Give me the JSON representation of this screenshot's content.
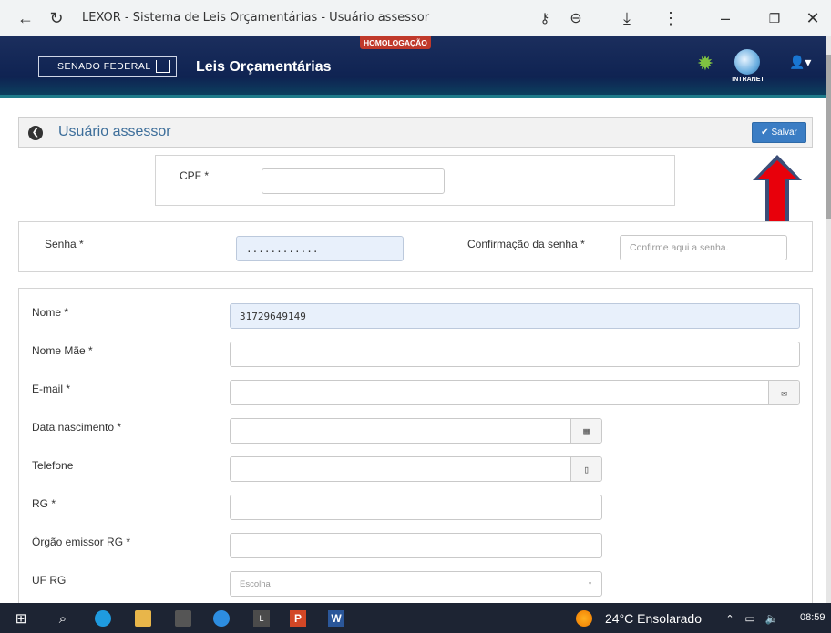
{
  "browser": {
    "tab_title": "LEXOR - Sistema de Leis Orçamentárias - Usuário assessor",
    "icons": [
      "back-arrow-icon",
      "reload-icon",
      "key-icon",
      "zoom-out-icon",
      "download-icon",
      "menu-dots-icon",
      "minimize-icon",
      "restore-icon",
      "close-icon"
    ]
  },
  "header": {
    "brand": "SENADO FEDERAL",
    "app_name": "Leis Orçamentárias",
    "environment_badge": "HOMOLOGAÇÃO",
    "intranet_label": "INTRANET",
    "colors": {
      "header_bg": "#0f2352",
      "badge": "#c0392b",
      "accent": "#1f7b8a"
    }
  },
  "page": {
    "title": "Usuário assessor",
    "save_label": "Salvar",
    "save_color": "#3b7dc4"
  },
  "form": {
    "cpf": {
      "label": "CPF *",
      "value": ""
    },
    "senha": {
      "label": "Senha *",
      "value": "............"
    },
    "confirmacao": {
      "label": "Confirmação da senha *",
      "placeholder": "Confirme aqui a senha."
    },
    "nome": {
      "label": "Nome *",
      "value": "31729649149"
    },
    "nome_mae": {
      "label": "Nome Mãe *",
      "value": ""
    },
    "email": {
      "label": "E-mail *",
      "value": ""
    },
    "data_nascimento": {
      "label": "Data nascimento *",
      "value": ""
    },
    "telefone": {
      "label": "Telefone",
      "value": ""
    },
    "rg": {
      "label": "RG *",
      "value": ""
    },
    "orgao_emissor": {
      "label": "Órgão emissor RG *",
      "value": ""
    },
    "uf_rg": {
      "label": "UF RG",
      "selected": "Escolha"
    }
  },
  "annotation": {
    "arrow_color": "#e8000b",
    "arrow_outline": "#3c4e78"
  },
  "taskbar": {
    "weather": "24°C  Ensolarado",
    "clock": "08:59",
    "icons": [
      "windows-start-icon",
      "search-icon",
      "edge-icon",
      "file-explorer-icon",
      "calculator-icon",
      "media-icon",
      "app-l-icon",
      "powerpoint-icon",
      "word-icon",
      "weather-sun-icon",
      "tray-up-icon",
      "network-icon",
      "volume-icon"
    ]
  }
}
